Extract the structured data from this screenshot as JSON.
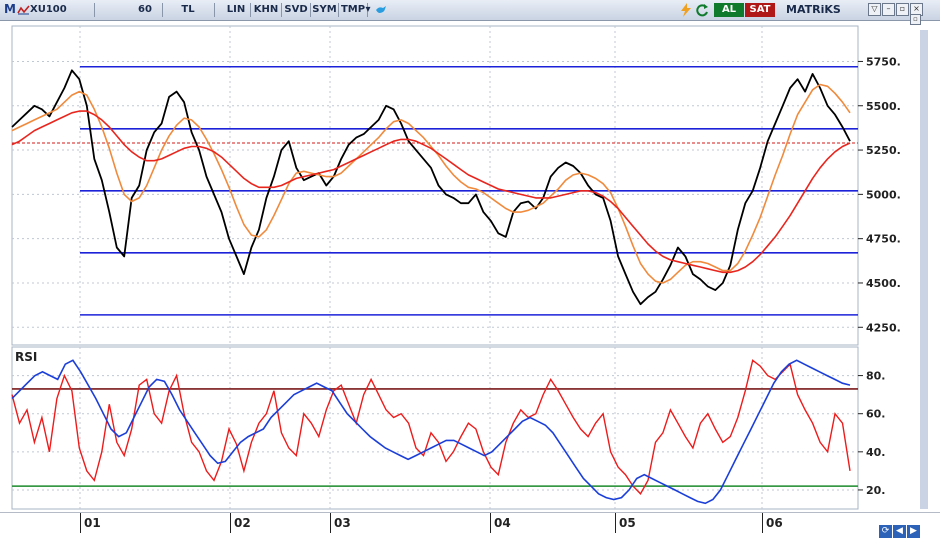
{
  "toolbar": {
    "app_mark": "M",
    "symbol": "XU100",
    "period": "60",
    "currency": "TL",
    "buttons": [
      "LIN",
      "KHN",
      "SVD",
      "SYM",
      "TMP"
    ],
    "buy": "AL",
    "sell": "SAT",
    "brand": "MATRiKS"
  },
  "price_axis": {
    "ticks": [
      "5750.",
      "5500.",
      "5250.",
      "5000.",
      "4750.",
      "4500.",
      "4250."
    ]
  },
  "rsi_panel": {
    "label": "RSI",
    "ticks": [
      "80.",
      "60.",
      "40.",
      "20."
    ]
  },
  "date_axis": {
    "ticks": [
      "01",
      "02",
      "03",
      "04",
      "05",
      "06"
    ]
  },
  "colors": {
    "price": "#000000",
    "ma_fast": "#f08a3c",
    "ma_slow": "#e8261e",
    "support": "#1b22d8",
    "rsi": "#ee1b1b",
    "rsi_signal": "#1b3fd8",
    "rsi_upper": "#7a1a1a",
    "rsi_lower": "#1a8a2a",
    "buy": "#0f7a2b",
    "sell": "#b01818"
  },
  "chart_data": [
    {
      "type": "line",
      "title": "",
      "ylim": [
        4150,
        5950
      ],
      "x_ticks": [
        "01",
        "02",
        "03",
        "04",
        "05",
        "06"
      ],
      "horizontal_levels": [
        5720,
        5370,
        5020,
        4670,
        4320
      ],
      "reference_level": 5290,
      "series": [
        {
          "values": [
            5380,
            5420,
            5460,
            5500,
            5480,
            5440,
            5520,
            5600,
            5700,
            5650,
            5500,
            5200,
            5080,
            4900,
            4700,
            4650,
            4980,
            5050,
            5250,
            5350,
            5400,
            5550,
            5580,
            5520,
            5350,
            5250,
            5100,
            5000,
            4900,
            4750,
            4650,
            4550,
            4700,
            4800,
            4980,
            5100,
            5250,
            5300,
            5150,
            5080,
            5100,
            5120,
            5050,
            5100,
            5200,
            5280,
            5320,
            5340,
            5380,
            5420,
            5500,
            5480,
            5400,
            5300,
            5250,
            5200,
            5150,
            5050,
            5000,
            4980,
            4950,
            4950,
            5000,
            4900,
            4850,
            4780,
            4760,
            4900,
            4950,
            4960,
            4920,
            4980,
            5100,
            5150,
            5180,
            5160,
            5120,
            5050,
            5000,
            4980,
            4850,
            4650,
            4550,
            4450,
            4380,
            4420,
            4450,
            4520,
            4600,
            4700,
            4650,
            4550,
            4520,
            4480,
            4460,
            4500,
            4600,
            4800,
            4950,
            5020,
            5150,
            5300,
            5400,
            5500,
            5600,
            5650,
            5580,
            5680,
            5600,
            5500,
            5450,
            5380,
            5300
          ]
        },
        {
          "values": [
            5360,
            5380,
            5400,
            5420,
            5440,
            5460,
            5480,
            5520,
            5560,
            5580,
            5560,
            5480,
            5380,
            5260,
            5120,
            5000,
            4960,
            4980,
            5050,
            5150,
            5250,
            5330,
            5390,
            5430,
            5420,
            5380,
            5310,
            5230,
            5140,
            5040,
            4930,
            4830,
            4770,
            4760,
            4800,
            4880,
            4970,
            5060,
            5120,
            5130,
            5120,
            5110,
            5100,
            5100,
            5120,
            5160,
            5200,
            5240,
            5280,
            5320,
            5370,
            5410,
            5420,
            5400,
            5360,
            5320,
            5270,
            5220,
            5160,
            5110,
            5070,
            5040,
            5030,
            5010,
            4980,
            4950,
            4920,
            4900,
            4900,
            4910,
            4930,
            4950,
            4990,
            5030,
            5080,
            5110,
            5120,
            5110,
            5090,
            5060,
            5010,
            4920,
            4820,
            4710,
            4610,
            4550,
            4510,
            4500,
            4520,
            4560,
            4600,
            4620,
            4620,
            4610,
            4590,
            4570,
            4570,
            4610,
            4680,
            4770,
            4870,
            4990,
            5110,
            5220,
            5340,
            5450,
            5520,
            5590,
            5620,
            5610,
            5570,
            5520,
            5460
          ]
        },
        {
          "values": [
            5280,
            5300,
            5330,
            5360,
            5380,
            5400,
            5420,
            5440,
            5460,
            5470,
            5470,
            5450,
            5420,
            5380,
            5330,
            5280,
            5240,
            5210,
            5190,
            5190,
            5200,
            5220,
            5240,
            5260,
            5270,
            5270,
            5260,
            5240,
            5210,
            5170,
            5130,
            5090,
            5060,
            5040,
            5040,
            5040,
            5050,
            5070,
            5090,
            5100,
            5110,
            5120,
            5130,
            5140,
            5160,
            5180,
            5200,
            5220,
            5240,
            5260,
            5280,
            5300,
            5310,
            5310,
            5300,
            5280,
            5260,
            5230,
            5200,
            5170,
            5140,
            5110,
            5090,
            5070,
            5050,
            5030,
            5020,
            5010,
            5000,
            4990,
            4980,
            4980,
            4980,
            4990,
            5000,
            5010,
            5020,
            5020,
            5010,
            4990,
            4960,
            4920,
            4870,
            4820,
            4770,
            4720,
            4680,
            4650,
            4630,
            4620,
            4610,
            4600,
            4590,
            4580,
            4570,
            4560,
            4560,
            4570,
            4590,
            4620,
            4660,
            4710,
            4760,
            4820,
            4880,
            4950,
            5020,
            5090,
            5150,
            5200,
            5240,
            5270,
            5290
          ]
        }
      ]
    },
    {
      "type": "line",
      "title": "",
      "ylim": [
        10,
        95
      ],
      "x_ticks": [
        "01",
        "02",
        "03",
        "04",
        "05",
        "06"
      ],
      "horizontal_levels": [
        73,
        22
      ],
      "series": [
        {
          "values": [
            70,
            55,
            62,
            45,
            58,
            40,
            68,
            80,
            72,
            42,
            30,
            25,
            40,
            65,
            45,
            38,
            52,
            75,
            78,
            60,
            55,
            72,
            80,
            60,
            45,
            40,
            30,
            25,
            35,
            52,
            44,
            30,
            45,
            55,
            60,
            72,
            50,
            42,
            38,
            60,
            55,
            48,
            62,
            72,
            75,
            65,
            55,
            70,
            78,
            70,
            62,
            58,
            60,
            55,
            42,
            38,
            50,
            45,
            35,
            40,
            48,
            55,
            52,
            40,
            32,
            28,
            45,
            55,
            62,
            58,
            60,
            70,
            78,
            72,
            65,
            58,
            52,
            48,
            55,
            60,
            40,
            32,
            28,
            22,
            18,
            25,
            45,
            50,
            62,
            55,
            48,
            42,
            55,
            60,
            52,
            45,
            48,
            58,
            72,
            88,
            85,
            80,
            78,
            82,
            86,
            70,
            62,
            55,
            45,
            40,
            60,
            55,
            30
          ]
        },
        {
          "values": [
            68,
            72,
            76,
            80,
            82,
            80,
            78,
            86,
            88,
            82,
            75,
            68,
            60,
            52,
            48,
            50,
            58,
            66,
            74,
            78,
            77,
            70,
            62,
            56,
            50,
            44,
            38,
            34,
            35,
            40,
            45,
            48,
            50,
            52,
            58,
            62,
            66,
            70,
            72,
            74,
            76,
            74,
            72,
            66,
            60,
            56,
            52,
            48,
            45,
            42,
            40,
            38,
            36,
            38,
            40,
            42,
            44,
            46,
            46,
            44,
            42,
            40,
            38,
            40,
            44,
            48,
            52,
            56,
            58,
            56,
            54,
            50,
            44,
            38,
            32,
            26,
            22,
            18,
            16,
            15,
            16,
            20,
            26,
            28,
            26,
            24,
            22,
            20,
            18,
            16,
            14,
            13,
            15,
            20,
            28,
            36,
            44,
            52,
            60,
            68,
            76,
            82,
            86,
            88,
            86,
            84,
            82,
            80,
            78,
            76,
            75
          ]
        }
      ]
    }
  ]
}
